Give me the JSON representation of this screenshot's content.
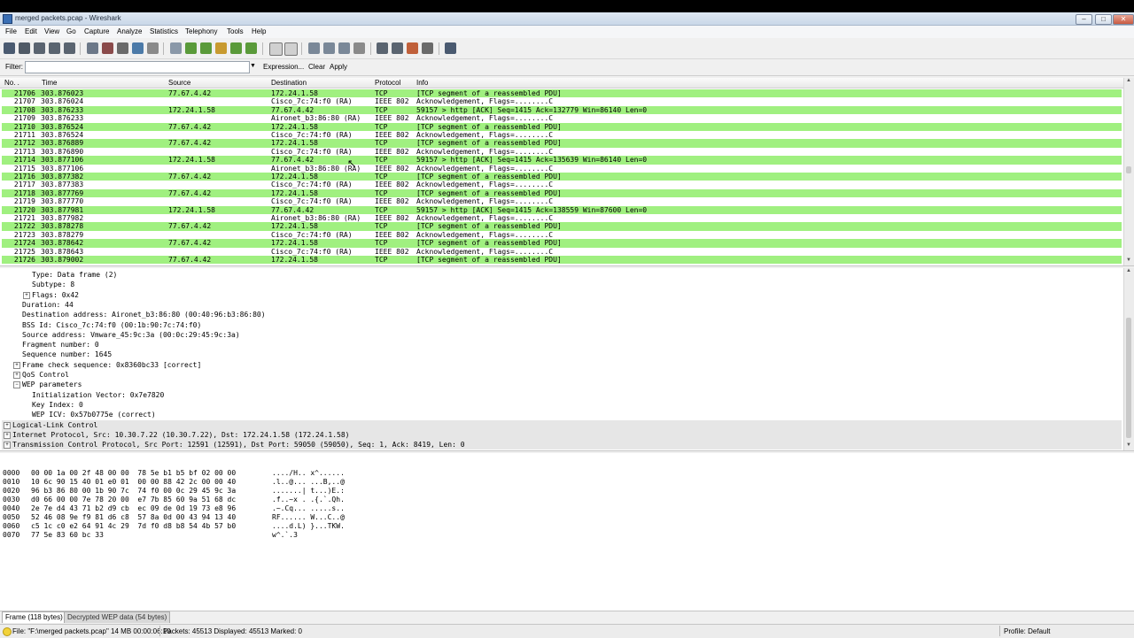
{
  "window": {
    "title": "merged packets.pcap - Wireshark"
  },
  "menu": [
    "File",
    "Edit",
    "View",
    "Go",
    "Capture",
    "Analyze",
    "Statistics",
    "Telephony",
    "Tools",
    "Help"
  ],
  "filter": {
    "label": "Filter:",
    "value": "",
    "expression": "Expression...",
    "clear": "Clear",
    "apply": "Apply"
  },
  "columns": {
    "no": "No. .",
    "time": "Time",
    "source": "Source",
    "destination": "Destination",
    "protocol": "Protocol",
    "info": "Info"
  },
  "packets": [
    {
      "no": "21706",
      "time": "303.876023",
      "src": "77.67.4.42",
      "dst": "172.24.1.58",
      "proto": "TCP",
      "info": "[TCP segment of a reassembled PDU]",
      "type": "tcp"
    },
    {
      "no": "21707",
      "time": "303.876024",
      "src": "",
      "dst": "Cisco_7c:74:f0 (RA)",
      "proto": "IEEE 802",
      "info": "Acknowledgement, Flags=........C",
      "type": "wlan"
    },
    {
      "no": "21708",
      "time": "303.876233",
      "src": "172.24.1.58",
      "dst": "77.67.4.42",
      "proto": "TCP",
      "info": "59157 > http [ACK] Seq=1415 Ack=132779 Win=86140 Len=0",
      "type": "tcp"
    },
    {
      "no": "21709",
      "time": "303.876233",
      "src": "",
      "dst": "Aironet_b3:86:80 (RA)",
      "proto": "IEEE 802",
      "info": "Acknowledgement, Flags=........C",
      "type": "wlan"
    },
    {
      "no": "21710",
      "time": "303.876524",
      "src": "77.67.4.42",
      "dst": "172.24.1.58",
      "proto": "TCP",
      "info": "[TCP segment of a reassembled PDU]",
      "type": "tcp"
    },
    {
      "no": "21711",
      "time": "303.876524",
      "src": "",
      "dst": "Cisco_7c:74:f0 (RA)",
      "proto": "IEEE 802",
      "info": "Acknowledgement, Flags=........C",
      "type": "wlan"
    },
    {
      "no": "21712",
      "time": "303.876889",
      "src": "77.67.4.42",
      "dst": "172.24.1.58",
      "proto": "TCP",
      "info": "[TCP segment of a reassembled PDU]",
      "type": "tcp"
    },
    {
      "no": "21713",
      "time": "303.876890",
      "src": "",
      "dst": "Cisco_7c:74:f0 (RA)",
      "proto": "IEEE 802",
      "info": "Acknowledgement, Flags=........C",
      "type": "wlan"
    },
    {
      "no": "21714",
      "time": "303.877106",
      "src": "172.24.1.58",
      "dst": "77.67.4.42",
      "proto": "TCP",
      "info": "59157 > http [ACK] Seq=1415 Ack=135639 Win=86140 Len=0",
      "type": "tcp"
    },
    {
      "no": "21715",
      "time": "303.877106",
      "src": "",
      "dst": "Aironet_b3:86:80 (RA)",
      "proto": "IEEE 802",
      "info": "Acknowledgement, Flags=........C",
      "type": "wlan"
    },
    {
      "no": "21716",
      "time": "303.877382",
      "src": "77.67.4.42",
      "dst": "172.24.1.58",
      "proto": "TCP",
      "info": "[TCP segment of a reassembled PDU]",
      "type": "tcp"
    },
    {
      "no": "21717",
      "time": "303.877383",
      "src": "",
      "dst": "Cisco_7c:74:f0 (RA)",
      "proto": "IEEE 802",
      "info": "Acknowledgement, Flags=........C",
      "type": "wlan"
    },
    {
      "no": "21718",
      "time": "303.877769",
      "src": "77.67.4.42",
      "dst": "172.24.1.58",
      "proto": "TCP",
      "info": "[TCP segment of a reassembled PDU]",
      "type": "tcp"
    },
    {
      "no": "21719",
      "time": "303.877770",
      "src": "",
      "dst": "Cisco_7c:74:f0 (RA)",
      "proto": "IEEE 802",
      "info": "Acknowledgement, Flags=........C",
      "type": "wlan"
    },
    {
      "no": "21720",
      "time": "303.877981",
      "src": "172.24.1.58",
      "dst": "77.67.4.42",
      "proto": "TCP",
      "info": "59157 > http [ACK] Seq=1415 Ack=138559 Win=87600 Len=0",
      "type": "tcp"
    },
    {
      "no": "21721",
      "time": "303.877982",
      "src": "",
      "dst": "Aironet_b3:86:80 (RA)",
      "proto": "IEEE 802",
      "info": "Acknowledgement, Flags=........C",
      "type": "wlan"
    },
    {
      "no": "21722",
      "time": "303.878278",
      "src": "77.67.4.42",
      "dst": "172.24.1.58",
      "proto": "TCP",
      "info": "[TCP segment of a reassembled PDU]",
      "type": "tcp"
    },
    {
      "no": "21723",
      "time": "303.878279",
      "src": "",
      "dst": "Cisco_7c:74:f0 (RA)",
      "proto": "IEEE 802",
      "info": "Acknowledgement, Flags=........C",
      "type": "wlan"
    },
    {
      "no": "21724",
      "time": "303.878642",
      "src": "77.67.4.42",
      "dst": "172.24.1.58",
      "proto": "TCP",
      "info": "[TCP segment of a reassembled PDU]",
      "type": "tcp"
    },
    {
      "no": "21725",
      "time": "303.878643",
      "src": "",
      "dst": "Cisco_7c:74:f0 (RA)",
      "proto": "IEEE 802",
      "info": "Acknowledgement, Flags=........C",
      "type": "wlan"
    },
    {
      "no": "21726",
      "time": "303.879002",
      "src": "77.67.4.42",
      "dst": "172.24.1.58",
      "proto": "TCP",
      "info": "[TCP segment of a reassembled PDU]",
      "type": "tcp"
    }
  ],
  "row_colors": {
    "tcp": "#a0f080",
    "wlan": "#ffffff"
  },
  "details": [
    {
      "text": "Type: Data frame (2)",
      "indent": 2,
      "exp": ""
    },
    {
      "text": "Subtype: 8",
      "indent": 2,
      "exp": ""
    },
    {
      "text": "Flags: 0x42",
      "indent": 2,
      "exp": "+"
    },
    {
      "text": "Duration: 44",
      "indent": 1,
      "exp": ""
    },
    {
      "text": "Destination address: Aironet_b3:86:80 (00:40:96:b3:86:80)",
      "indent": 1,
      "exp": ""
    },
    {
      "text": "BSS Id: Cisco_7c:74:f0 (00:1b:90:7c:74:f0)",
      "indent": 1,
      "exp": ""
    },
    {
      "text": "Source address: Vmware_45:9c:3a (00:0c:29:45:9c:3a)",
      "indent": 1,
      "exp": ""
    },
    {
      "text": "Fragment number: 0",
      "indent": 1,
      "exp": ""
    },
    {
      "text": "Sequence number: 1645",
      "indent": 1,
      "exp": ""
    },
    {
      "text": "Frame check sequence: 0x8360bc33 [correct]",
      "indent": 1,
      "exp": "+"
    },
    {
      "text": "QoS Control",
      "indent": 1,
      "exp": "+"
    },
    {
      "text": "WEP parameters",
      "indent": 1,
      "exp": "-"
    },
    {
      "text": "Initialization Vector: 0x7e7820",
      "indent": 2,
      "exp": ""
    },
    {
      "text": "Key Index: 0",
      "indent": 2,
      "exp": ""
    },
    {
      "text": "WEP ICV: 0x57b0775e (correct)",
      "indent": 2,
      "exp": ""
    },
    {
      "text": "Logical-Link Control",
      "indent": 0,
      "exp": "+",
      "hl": true
    },
    {
      "text": "Internet Protocol, Src: 10.30.7.22 (10.30.7.22), Dst: 172.24.1.58 (172.24.1.58)",
      "indent": 0,
      "exp": "+",
      "hl": true
    },
    {
      "text": "Transmission Control Protocol, Src Port: 12591 (12591), Dst Port: 59050 (59050), Seq: 1, Ack: 8419, Len: 0",
      "indent": 0,
      "exp": "+",
      "hl": true
    }
  ],
  "hex": [
    {
      "off": "0000",
      "bytes": "00 00 1a 00 2f 48 00 00  78 5e b1 b5 bf 02 00 00",
      "ascii": "..../H.. x^......"
    },
    {
      "off": "0010",
      "bytes": "10 6c 90 15 40 01 e0 01  00 00 88 42 2c 00 00 40",
      "ascii": ".l..@... ...B,..@"
    },
    {
      "off": "0020",
      "bytes": "96 b3 86 80 00 1b 90 7c  74 f0 00 0c 29 45 9c 3a",
      "ascii": ".......| t...)E.:"
    },
    {
      "off": "0030",
      "bytes": "d0 66 00 00 7e 78 20 00  e7 7b 85 60 9a 51 68 dc",
      "ascii": ".f..~x . .{.`.Qh."
    },
    {
      "off": "0040",
      "bytes": "2e 7e d4 43 71 b2 d9 cb  ec 09 de 0d 19 73 e8 96",
      "ascii": ".~.Cq... .....s.."
    },
    {
      "off": "0050",
      "bytes": "52 46 08 9e f9 81 d6 c8  57 8a 0d 00 43 94 13 40",
      "ascii": "RF...... W...C..@"
    },
    {
      "off": "0060",
      "bytes": "c5 1c c0 e2 64 91 4c 29  7d f0 d8 b8 54 4b 57 b0",
      "ascii": "....d.L) }...TKW."
    },
    {
      "off": "0070",
      "bytes": "77 5e 83 60 bc 33",
      "ascii": "w^.`.3"
    }
  ],
  "tabs": [
    "Frame (118 bytes)",
    "Decrypted WEP data (54 bytes)"
  ],
  "status": {
    "file": "File: \"F:\\merged packets.pcap\" 14 MB 00:00:06:10",
    "packets": "Packets: 45513 Displayed: 45513 Marked: 0",
    "profile": "Profile: Default"
  }
}
